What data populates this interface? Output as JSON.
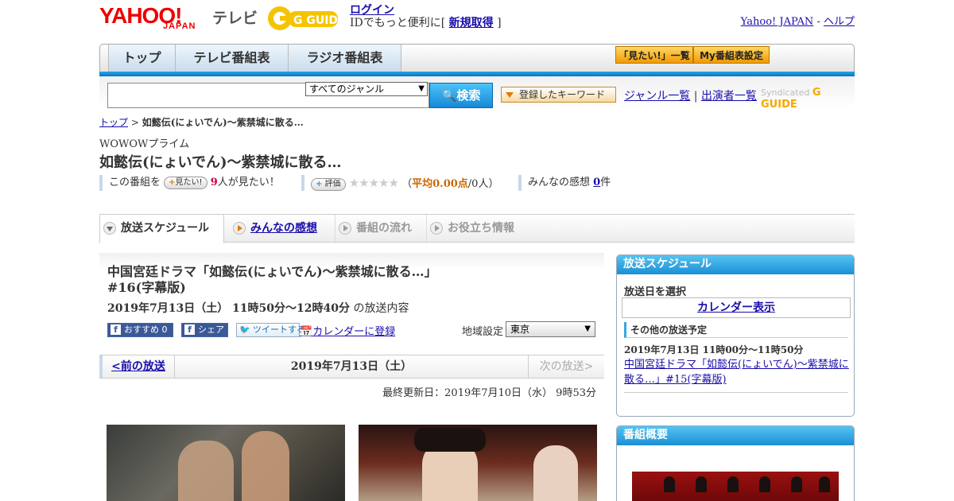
{
  "header": {
    "yahoo_logo": "YAHOO!",
    "japan": "JAPAN",
    "tv": "テレビ",
    "gguide": "G GUIDE",
    "login": "ログイン",
    "id_text": "IDでもっと便利に[",
    "new_reg": "新規取得",
    "bracket_close": "]",
    "yahoo_japan": "Yahoo! JAPAN",
    "dash": "-",
    "help": "ヘルプ"
  },
  "nav": {
    "tabs": [
      "トップ",
      "テレビ番組表",
      "ラジオ番組表"
    ],
    "watchlist": "「見たい!」一覧",
    "my_schedule": "My番組表設定"
  },
  "search": {
    "genre_select": "すべてのジャンル",
    "search_button": "検索",
    "keyword_button": "登録したキーワード",
    "genre_list": "ジャンル一覧",
    "separator": "|",
    "cast_list": "出演者一覧",
    "syndicated": "Syndicated"
  },
  "breadcrumb": {
    "top": "トップ",
    "sep": ">",
    "current": "如懿伝(にょいでん)～紫禁城に散る…"
  },
  "program": {
    "channel": "WOWOWプライム",
    "title": "如懿伝(にょいでん)～紫禁城に散る…",
    "this_program": "この番組を",
    "want_button": "見たい!",
    "want_count": "9",
    "want_suffix": "人が見たい！",
    "rate_button": "評価",
    "stars": "★★★★★",
    "avg_prefix": "（",
    "avg_label": "平均0.00点",
    "avg_people": "/0人）",
    "impressions_label": "みんなの感想",
    "impressions_count": "0",
    "impressions_suffix": "件"
  },
  "tabs": [
    "放送スケジュール",
    "みんなの感想",
    "番組の流れ",
    "お役立ち情報"
  ],
  "episode": {
    "title_line1": "中国宮廷ドラマ「如懿伝(にょいでん)～紫禁城に散る…」",
    "title_line2": "#16(字幕版)",
    "datetime": "2019年7月13日（土） 11時50分～12時40分",
    "datetime_suffix": "の放送内容",
    "share_recommend": "おすすめ",
    "share_count": "0",
    "share_fb": "シェア",
    "tweet": "ツイートする",
    "calendar_register": "カレンダーに登録",
    "region_label": "地域設定",
    "region_value": "東京"
  },
  "pager": {
    "prev": "<前の放送",
    "current": "2019年7月13日（土）",
    "next": "次の放送>"
  },
  "updated": "最終更新日：2019年7月10日（水） 9時53分",
  "sidebar": {
    "schedule_title": "放送スケジュール",
    "select_date": "放送日を選択",
    "calendar_view": "カレンダー表示",
    "other_broadcasts": "その他の放送予定",
    "other_date": "2019年7月13日 11時00分～11時50分",
    "other_link": "中国宮廷ドラマ「如懿伝(にょいでん)～紫禁城に散る…」#15(字幕版)",
    "overview_title": "番組概要"
  },
  "colors": {
    "accent_blue": "#1b8fd6",
    "yahoo_red": "#e00000",
    "gguide_yellow": "#f5a800"
  }
}
